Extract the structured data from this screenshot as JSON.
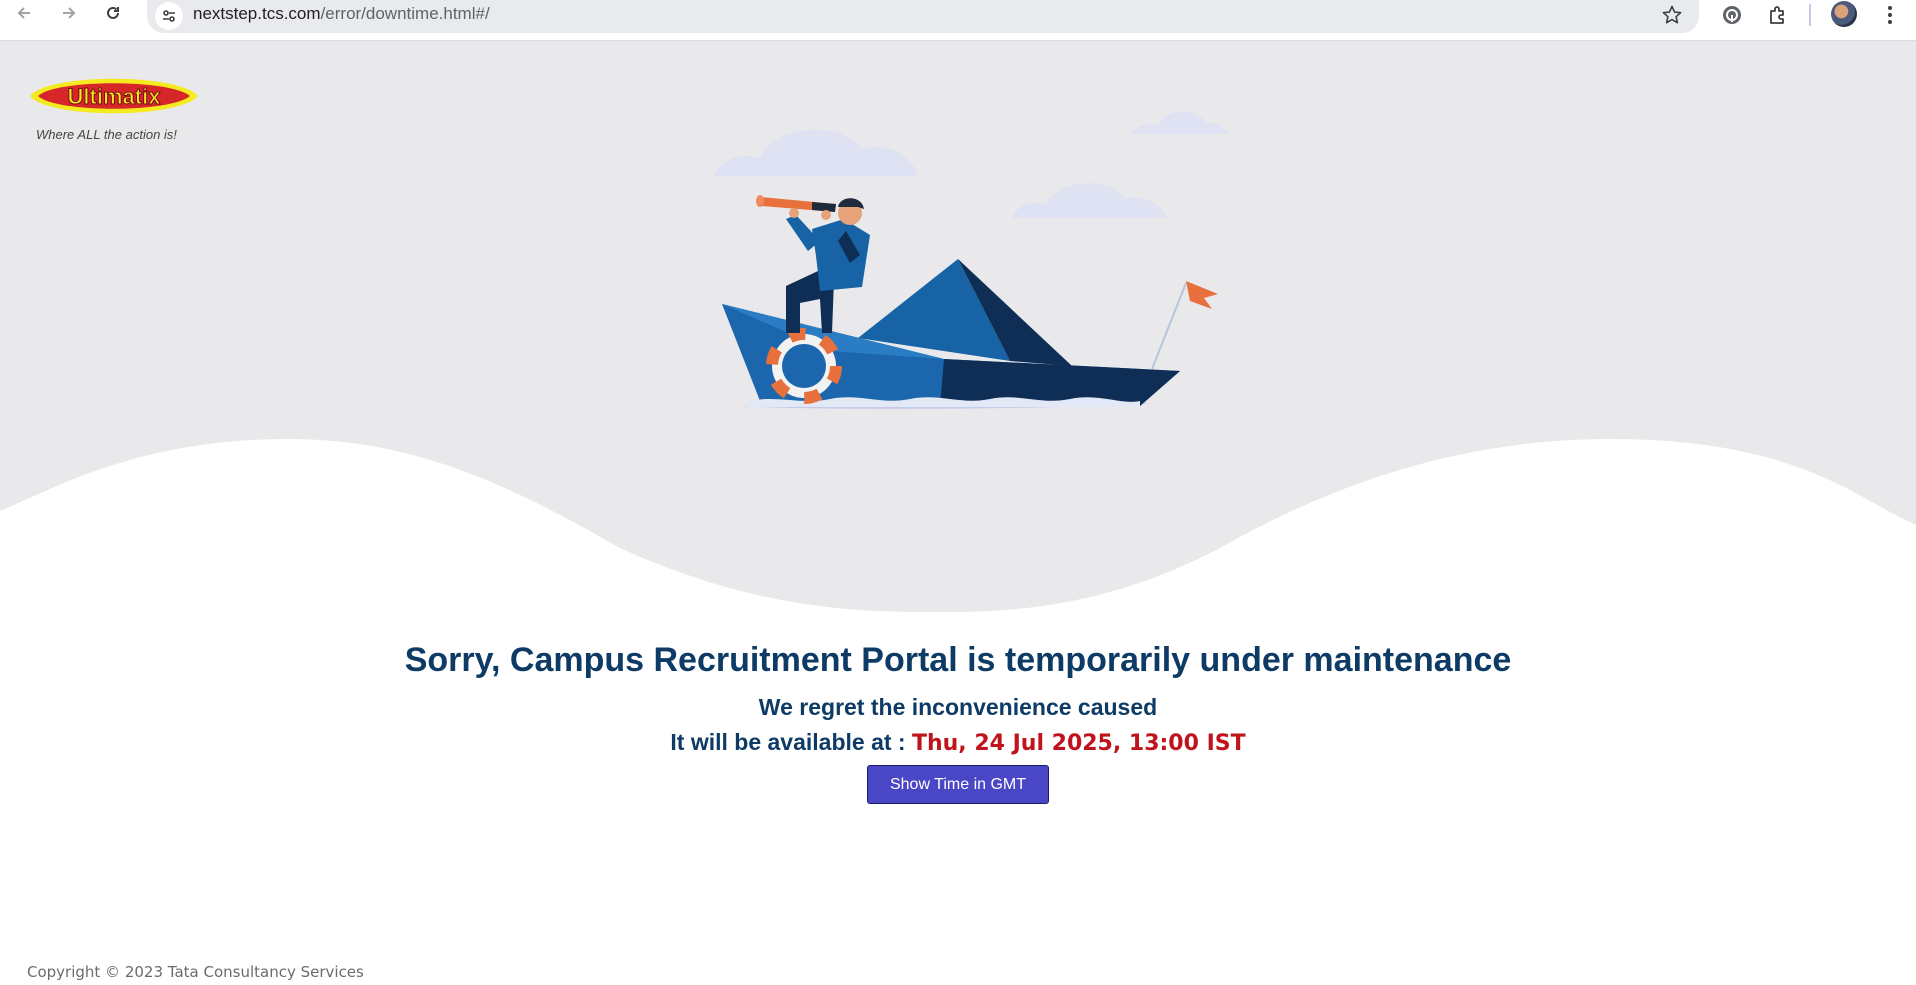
{
  "browser": {
    "url_host": "nextstep.tcs.com",
    "url_path": "/error/downtime.html#/"
  },
  "brand": {
    "logo_text": "Ultimatix",
    "tagline": "Where ALL the action is!"
  },
  "message": {
    "headline": "Sorry, Campus Recruitment Portal is temporarily under maintenance",
    "regret": "We regret the inconvenience caused",
    "available_label": "It will be available at : ",
    "available_time": "Thu, 24 Jul 2025, 13:00 IST",
    "gmt_button": "Show Time in GMT"
  },
  "footer": {
    "copyright": "Copyright © 2023 Tata Consultancy Services"
  },
  "icons": [
    "back-icon",
    "forward-icon",
    "reload-icon",
    "site-info-icon",
    "bookmark-star-icon",
    "extension-circle-icon",
    "extensions-puzzle-icon",
    "profile-avatar",
    "more-menu-icon"
  ],
  "colors": {
    "heading": "#0d3b66",
    "time_highlight": "#c0141d",
    "button": "#4a47c6",
    "hero_background": "#e9e9ec"
  }
}
